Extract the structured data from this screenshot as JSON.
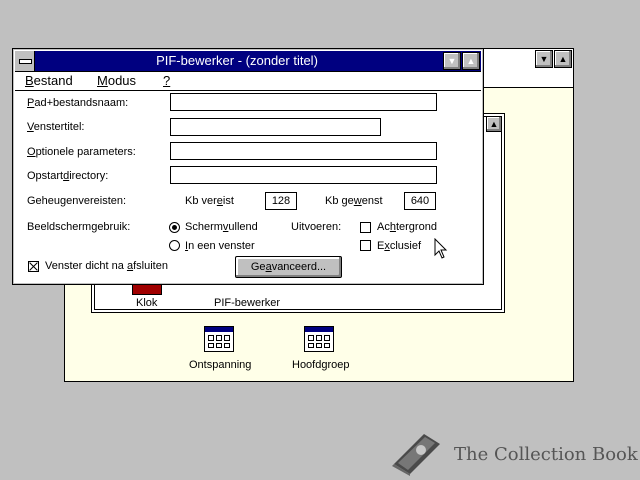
{
  "dialog": {
    "title": "PIF-bewerker - (zonder titel)",
    "menu": [
      {
        "label_first": "B",
        "label_rest": "estand"
      },
      {
        "label_first": "M",
        "label_rest": "odus"
      },
      {
        "label_first": "?",
        "label_rest": ""
      }
    ],
    "fields": {
      "path": {
        "label_first": "P",
        "label_rest": "ad+bestandsnaam:",
        "value": ""
      },
      "window_title": {
        "label_first": "V",
        "label_rest": "enstertitel:",
        "value": ""
      },
      "params": {
        "label_first": "O",
        "label_rest": "ptionele parameters:",
        "value": ""
      },
      "startdir_prefix": "Opstart",
      "startdir_underlined": "d",
      "startdir_suffix": "irectory:",
      "startdir_value": ""
    },
    "memory": {
      "label": "Geheugenvereisten:",
      "required_prefix": "Kb ver",
      "required_underlined": "e",
      "required_suffix": "ist",
      "required_value": "128",
      "desired_prefix": "Kb ge",
      "desired_underlined": "w",
      "desired_suffix": "enst",
      "desired_value": "640"
    },
    "display": {
      "label": "Beeldschermgebruik:",
      "fullscreen_prefix": "Scherm",
      "fullscreen_underlined": "v",
      "fullscreen_suffix": "ullend",
      "windowed_first": "I",
      "windowed_rest": "n een venster"
    },
    "execution": {
      "label": "Uitvoeren:",
      "background_prefix": "Ac",
      "background_underlined": "h",
      "background_suffix": "tergrond",
      "exclusive_prefix": "E",
      "exclusive_underlined": "x",
      "exclusive_suffix": "clusief"
    },
    "close_on_exit_prefix": "Venster dicht na ",
    "close_on_exit_underlined": "a",
    "close_on_exit_suffix": "fsluiten",
    "advanced_prefix": "Ge",
    "advanced_underlined": "a",
    "advanced_suffix": "vanceerd..."
  },
  "background": {
    "icons": [
      {
        "label": "Klok"
      },
      {
        "label": "PIF-bewerker"
      },
      {
        "label": "Ontspanning"
      },
      {
        "label": "Hoofdgroep"
      }
    ]
  },
  "watermark": {
    "text": "The Collection Book"
  },
  "icons": {
    "down": "▼",
    "up": "▲"
  }
}
